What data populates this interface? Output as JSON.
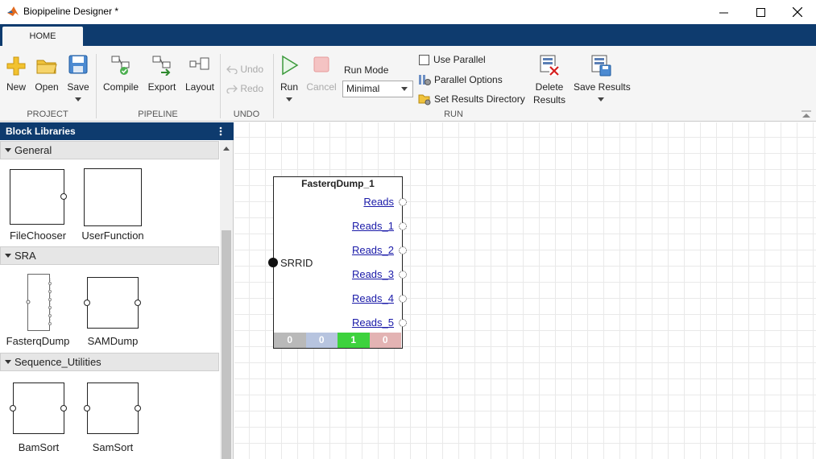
{
  "window": {
    "title": "Biopipeline Designer *",
    "minimize": "—",
    "maximize": "☐",
    "close": "✕"
  },
  "tabs": [
    {
      "label": "HOME"
    }
  ],
  "ribbon": {
    "project": {
      "label": "PROJECT",
      "new": "New",
      "open": "Open",
      "save": "Save"
    },
    "pipeline": {
      "label": "PIPELINE",
      "compile": "Compile",
      "export": "Export",
      "layout": "Layout"
    },
    "undo": {
      "label": "UNDO",
      "undo": "Undo",
      "redo": "Redo"
    },
    "run": {
      "label": "RUN",
      "run": "Run",
      "cancel": "Cancel",
      "run_mode_label": "Run Mode",
      "run_mode_value": "Minimal",
      "use_parallel": "Use Parallel",
      "parallel_options": "Parallel Options",
      "set_results_directory": "Set Results Directory",
      "delete_results_1": "Delete",
      "delete_results_2": "Results",
      "save_results": "Save Results"
    }
  },
  "sidebar": {
    "title": "Block Libraries",
    "categories": [
      {
        "name": "General",
        "blocks": [
          "FileChooser",
          "UserFunction"
        ]
      },
      {
        "name": "SRA",
        "blocks": [
          "FasterqDump",
          "SAMDump"
        ]
      },
      {
        "name": "Sequence_Utilities",
        "blocks": [
          "BamSort",
          "SamSort"
        ]
      }
    ]
  },
  "canvas": {
    "node": {
      "title": "FasterqDump_1",
      "input": "SRRID",
      "outputs": [
        "Reads",
        "Reads_1",
        "Reads_2",
        "Reads_3",
        "Reads_4",
        "Reads_5"
      ],
      "status": [
        {
          "value": "0",
          "color": "#b9b9b9"
        },
        {
          "value": "0",
          "color": "#b7c4df"
        },
        {
          "value": "1",
          "color": "#3dd23d"
        },
        {
          "value": "0",
          "color": "#e3b3b3"
        }
      ]
    }
  }
}
